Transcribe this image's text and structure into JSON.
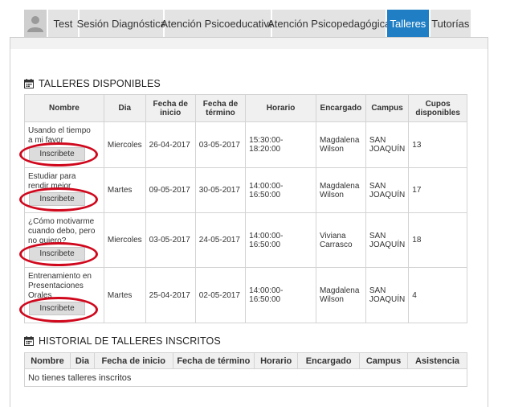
{
  "tabs": [
    {
      "label": "Test"
    },
    {
      "label": "Sesión Diagnóstica"
    },
    {
      "label": "Atención Psicoeducativa"
    },
    {
      "label": "Atención Psicopedagógica"
    },
    {
      "label": "Talleres"
    },
    {
      "label": "Tutorías"
    }
  ],
  "active_tab": "Talleres",
  "available": {
    "title": "TALLERES DISPONIBLES",
    "icon": "calendar-icon",
    "columns": {
      "nombre": "Nombre",
      "dia": "Dia",
      "inicio": "Fecha de inicio",
      "termino": "Fecha de término",
      "horario": "Horario",
      "encargado": "Encargado",
      "campus": "Campus",
      "cupos": "Cupos disponibles"
    },
    "rows": [
      {
        "nombre": "Usando el tiempo a mi favor",
        "dia": "Miercoles",
        "inicio": "26-04-2017",
        "termino": "03-05-2017",
        "horario": "15:30:00-18:20:00",
        "encargado": "Magdalena Wilson",
        "campus": "SAN JOAQUÍN",
        "cupos": "13",
        "button": "Inscribete"
      },
      {
        "nombre": "Estudiar para rendir mejor",
        "dia": "Martes",
        "inicio": "09-05-2017",
        "termino": "30-05-2017",
        "horario": "14:00:00-16:50:00",
        "encargado": "Magdalena Wilson",
        "campus": "SAN JOAQUÍN",
        "cupos": "17",
        "button": "Inscribete"
      },
      {
        "nombre": "¿Cómo motivarme cuando debo, pero no quiero?",
        "dia": "Miercoles",
        "inicio": "03-05-2017",
        "termino": "24-05-2017",
        "horario": "14:00:00-16:50:00",
        "encargado": "Viviana Carrasco",
        "campus": "SAN JOAQUÍN",
        "cupos": "18",
        "button": "Inscribete"
      },
      {
        "nombre": "Entrenamiento en Presentaciones Orales",
        "dia": "Martes",
        "inicio": "25-04-2017",
        "termino": "02-05-2017",
        "horario": "14:00:00-16:50:00",
        "encargado": "Magdalena Wilson",
        "campus": "SAN JOAQUÍN",
        "cupos": "4",
        "button": "Inscribete"
      }
    ]
  },
  "history": {
    "title": "HISTORIAL DE TALLERES INSCRITOS",
    "icon": "calendar-icon",
    "columns": [
      "Nombre",
      "Dia",
      "Fecha de inicio",
      "Fecha de término",
      "Horario",
      "Encargado",
      "Campus",
      "Asistencia"
    ],
    "empty_text": "No tienes talleres inscritos"
  },
  "colors": {
    "active_tab": "#1f7ec4",
    "annotation_ring": "#d0081d"
  }
}
